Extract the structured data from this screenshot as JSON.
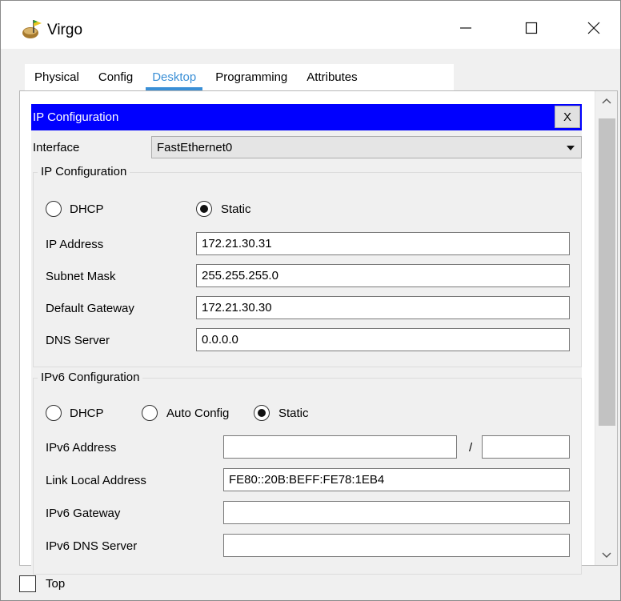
{
  "window": {
    "title": "Virgo",
    "icon": "router-flag-icon"
  },
  "tabs": [
    {
      "label": "Physical"
    },
    {
      "label": "Config"
    },
    {
      "label": "Desktop"
    },
    {
      "label": "Programming"
    },
    {
      "label": "Attributes"
    }
  ],
  "active_tab": "Desktop",
  "ip_config": {
    "header": "IP Configuration",
    "close_label": "X",
    "interface_label": "Interface",
    "interface_value": "FastEthernet0",
    "ipv4": {
      "legend": "IP Configuration",
      "dhcp_label": "DHCP",
      "static_label": "Static",
      "mode": "Static",
      "ip_label": "IP Address",
      "ip_value": "172.21.30.31",
      "mask_label": "Subnet Mask",
      "mask_value": "255.255.255.0",
      "gateway_label": "Default Gateway",
      "gateway_value": "172.21.30.30",
      "dns_label": "DNS Server",
      "dns_value": "0.0.0.0"
    },
    "ipv6": {
      "legend": "IPv6 Configuration",
      "dhcp_label": "DHCP",
      "auto_label": "Auto Config",
      "static_label": "Static",
      "mode": "Static",
      "addr_label": "IPv6 Address",
      "addr_value": "",
      "slash": "/",
      "prefix_value": "",
      "link_local_label": "Link Local Address",
      "link_local_value": "FE80::20B:BEFF:FE78:1EB4",
      "gateway_label": "IPv6 Gateway",
      "gateway_value": "",
      "dns_label": "IPv6 DNS Server",
      "dns_value": ""
    }
  },
  "footer": {
    "top_label": "Top",
    "top_checked": false
  },
  "colors": {
    "header_bg": "#0000ff",
    "active_tab": "#3a8fd6"
  }
}
